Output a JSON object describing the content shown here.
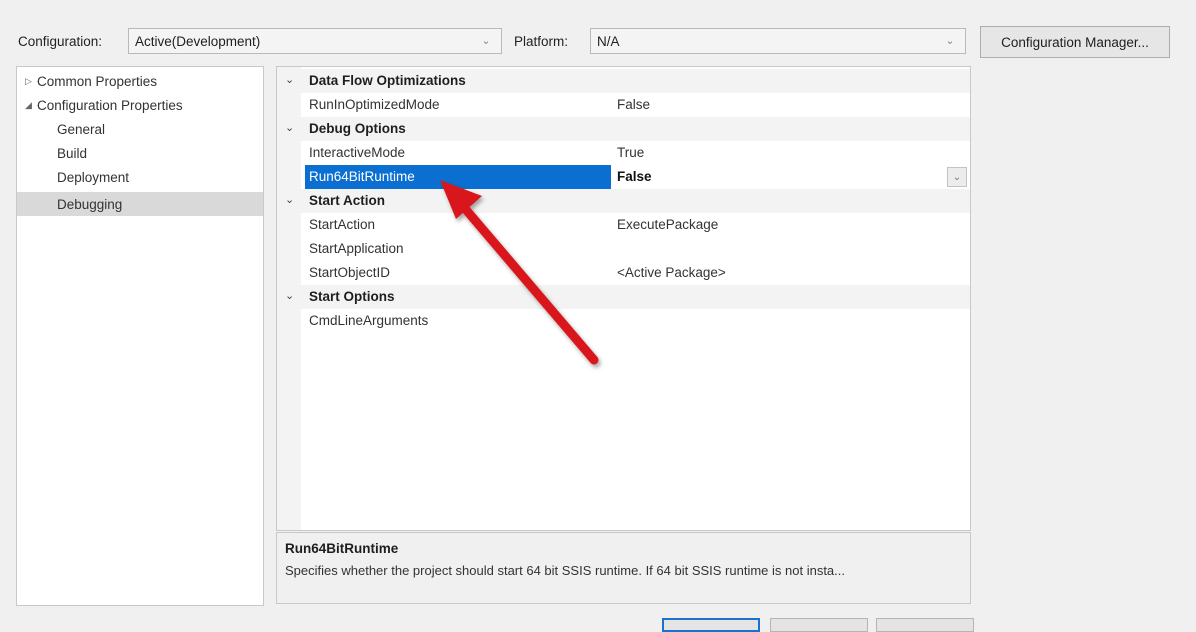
{
  "toolbar": {
    "configuration_label": "Configuration:",
    "configuration_value": "Active(Development)",
    "platform_label": "Platform:",
    "platform_value": "N/A",
    "config_manager_label": "Configuration Manager..."
  },
  "tree": {
    "common": "Common Properties",
    "configuration": "Configuration Properties",
    "children": [
      "General",
      "Build",
      "Deployment",
      "Debugging"
    ],
    "selected": "Debugging"
  },
  "grid": {
    "categories": {
      "data_flow": "Data Flow Optimizations",
      "debug_options": "Debug Options",
      "start_action": "Start Action",
      "start_options": "Start Options"
    },
    "props": {
      "run_in_optimized_mode": {
        "name": "RunInOptimizedMode",
        "value": "False"
      },
      "interactive_mode": {
        "name": "InteractiveMode",
        "value": "True"
      },
      "run64bit_runtime": {
        "name": "Run64BitRuntime",
        "value": "False"
      },
      "start_action": {
        "name": "StartAction",
        "value": "ExecutePackage"
      },
      "start_application": {
        "name": "StartApplication",
        "value": ""
      },
      "start_object_id": {
        "name": "StartObjectID",
        "value": "<Active Package>"
      },
      "cmd_line_arguments": {
        "name": "CmdLineArguments",
        "value": ""
      }
    }
  },
  "description": {
    "title": "Run64BitRuntime",
    "text": "Specifies whether the project should start 64 bit SSIS runtime. If 64 bit SSIS runtime is not insta..."
  },
  "colors": {
    "selection": "#0a6fd1",
    "arrow": "#d8171b"
  },
  "icons": {
    "expand": "chevron-down-icon",
    "dropdown": "chevron-down-icon",
    "collapsed": "triangle-right-icon",
    "expanded": "triangle-down-icon"
  }
}
